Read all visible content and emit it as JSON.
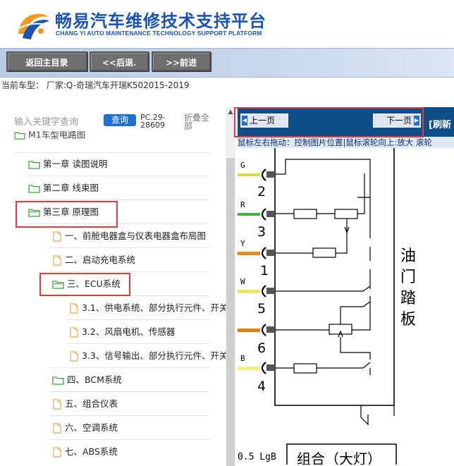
{
  "brand": {
    "name_cn": "畅易汽车维修技术支持平台",
    "name_en": "CHANG YI AUTO MAINTENANCE TECHNOLOGY SUPPORT PLATFORM"
  },
  "toolbar": {
    "home_label": "返回主目录",
    "back_label": "<<后退.",
    "forward_label": ">>前进"
  },
  "current_vehicle": "当前车型：  厂家:Q-奇瑞汽车开瑞K502015-2019",
  "search": {
    "placeholder": "输入关键字查询",
    "query_label": "查询",
    "pc_code": "PC.29-28609",
    "collapse_label": "折叠全部"
  },
  "tree": {
    "root_label": "M1车型电路图",
    "chapters": [
      {
        "label": "第一章 读图说明"
      },
      {
        "label": "第二章 线束图"
      },
      {
        "label": "第三章 原理图"
      }
    ],
    "chapter3_items": [
      {
        "label": "一、前舱电器盒与仪表电器盒布局图",
        "type": "file"
      },
      {
        "label": "二、启动充电系统",
        "type": "file"
      },
      {
        "label": "三、ECU系统",
        "type": "folder"
      },
      {
        "label": "3.1、供电系统、部分执行元件、开关",
        "type": "file"
      },
      {
        "label": "3.2、风扇电机、传感器",
        "type": "file"
      },
      {
        "label": "3.3、信号输出、部分执行元件、开关",
        "type": "file"
      },
      {
        "label": "四、BCM系统",
        "type": "folder"
      },
      {
        "label": "五、组合仪表",
        "type": "file"
      },
      {
        "label": "六、空调系统",
        "type": "file"
      },
      {
        "label": "七、ABS系统",
        "type": "file"
      }
    ]
  },
  "viewer": {
    "prev_label": "上一页",
    "next_label": "下一页",
    "refresh_label": "[刷新",
    "hint": "鼠标左右拖动：控制图片位置|鼠标滚轮向上:放大  滚轮",
    "diagram": {
      "pins": [
        {
          "color_code": "G",
          "number": "2",
          "color": "#d8d840"
        },
        {
          "color_code": "R",
          "number": "3",
          "color": "#3bb83b"
        },
        {
          "color_code": "Y",
          "number": "1",
          "color": "#e98a1c"
        },
        {
          "color_code": "W",
          "number": "5",
          "color": "#e8e85a"
        },
        {
          "color_code": "",
          "number": "6",
          "color": "#ee7a14"
        },
        {
          "color_code": "B",
          "number": "4",
          "color": "#f0f07a"
        }
      ],
      "component_label": "油门踏板",
      "bottom_wire": "0.5 LgB",
      "bottom_box": "组合（大灯）"
    }
  },
  "colors": {
    "accent_blue": "#1a54b0",
    "nav_blue": "#0f4c8a",
    "highlight_red": "#e23b3b"
  }
}
